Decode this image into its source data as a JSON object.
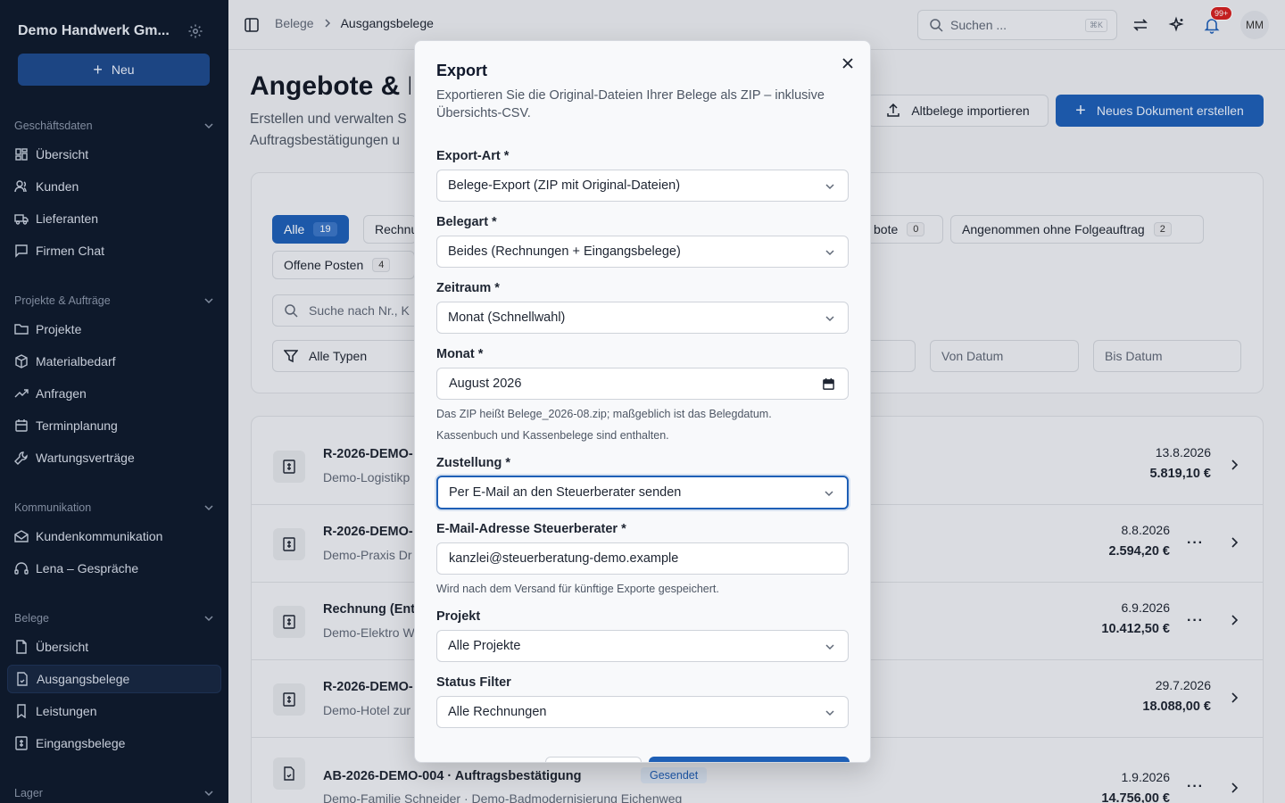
{
  "sidebar": {
    "company": "Demo Handwerk Gm...",
    "new_button": "Neu",
    "sections": [
      {
        "label": "Geschäftsdaten",
        "items": [
          "Übersicht",
          "Kunden",
          "Lieferanten",
          "Firmen Chat"
        ]
      },
      {
        "label": "Projekte & Aufträge",
        "items": [
          "Projekte",
          "Materialbedarf",
          "Anfragen",
          "Terminplanung",
          "Wartungsverträge"
        ]
      },
      {
        "label": "Kommunikation",
        "items": [
          "Kundenkommunikation",
          "Lena – Gespräche"
        ]
      },
      {
        "label": "Belege",
        "items": [
          "Übersicht",
          "Ausgangsbelege",
          "Leistungen",
          "Eingangsbelege"
        ]
      },
      {
        "label": "Lager",
        "items": []
      }
    ],
    "active_item": "Ausgangsbelege"
  },
  "topbar": {
    "breadcrumb": [
      "Belege",
      "Ausgangsbelege"
    ],
    "search_placeholder": "Suchen ...",
    "search_shortcut": "⌘K",
    "notification_count": "99+",
    "avatar_initials": "MM"
  },
  "page": {
    "title": "Angebote & R",
    "subtitle": "Erstellen und verwalten S Auftragsbestätigungen u",
    "import_button": "Altbelege importieren",
    "create_button": "Neues Dokument erstellen",
    "chips": [
      {
        "label": "Alle",
        "count": "19"
      },
      {
        "label": "Rechnu",
        "count": ""
      },
      {
        "label": "bote",
        "count": "0"
      },
      {
        "label": "Angenommen ohne Folgeauftrag",
        "count": "2"
      },
      {
        "label": "Offene Posten",
        "count": "4"
      }
    ],
    "search_placeholder": "Suche nach Nr., K",
    "type_filter": "Alle Typen",
    "from_date": "Von Datum",
    "to_date": "Bis Datum",
    "rows": [
      {
        "title": "R-2026-DEMO-",
        "sub": "Demo-Logistikp",
        "date": "13.8.2026",
        "amount": "5.819,10 €"
      },
      {
        "title": "R-2026-DEMO-",
        "sub": "Demo-Praxis Dr",
        "date": "8.8.2026",
        "amount": "2.594,20 €"
      },
      {
        "title": "Rechnung (Entv",
        "sub": "Demo-Elektro W",
        "date": "6.9.2026",
        "amount": "10.412,50 €"
      },
      {
        "title": "R-2026-DEMO-",
        "sub": "Demo-Hotel zur",
        "date": "29.7.2026",
        "amount": "18.088,00 €"
      },
      {
        "title": "AB-2026-DEMO-004 · Auftragsbestätigung",
        "sub": "Demo-Familie Schneider · Demo-Badmodernisierung Eichenweg",
        "date": "1.9.2026",
        "amount": "14.756,00 €",
        "badge": "Gesendet"
      }
    ]
  },
  "modal": {
    "title": "Export",
    "description": "Exportieren Sie die Original-Dateien Ihrer Belege als ZIP – inklusive Übersichts-CSV.",
    "fields": {
      "export_type": {
        "label": "Export-Art *",
        "value": "Belege-Export (ZIP mit Original-Dateien)"
      },
      "doc_type": {
        "label": "Belegart *",
        "value": "Beides (Rechnungen + Eingangsbelege)"
      },
      "period": {
        "label": "Zeitraum *",
        "value": "Monat (Schnellwahl)"
      },
      "month": {
        "label": "Monat *",
        "value": "August 2026",
        "hint1": "Das ZIP heißt Belege_2026-08.zip; maßgeblich ist das Belegdatum.",
        "hint2": "Kassenbuch und Kassenbelege sind enthalten."
      },
      "delivery": {
        "label": "Zustellung *",
        "value": "Per E-Mail an den Steuerberater senden"
      },
      "email": {
        "label": "E-Mail-Adresse Steuerberater *",
        "value": "kanzlei@steuerberatung-demo.example",
        "hint": "Wird nach dem Versand für künftige Exporte gespeichert."
      },
      "project": {
        "label": "Projekt",
        "value": "Alle Projekte"
      },
      "status": {
        "label": "Status Filter",
        "value": "Alle Rechnungen"
      }
    }
  },
  "colors": {
    "sidebar_bg": "#0f1b2d",
    "accent": "#1e5fb6",
    "badge_red": "#d32121"
  }
}
